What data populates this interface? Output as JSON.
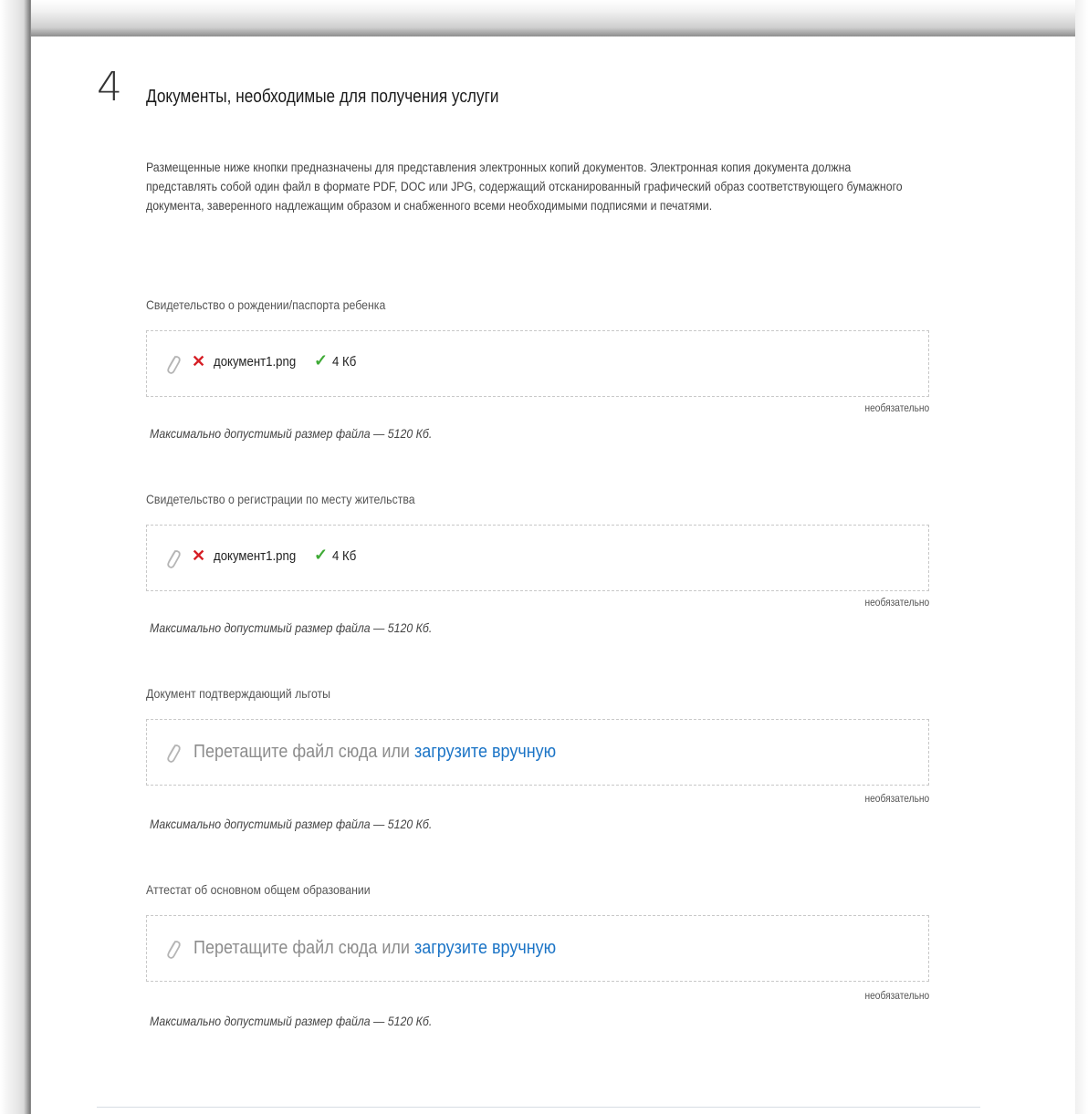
{
  "section": {
    "number": "4",
    "title": "Документы, необходимые для получения услуги",
    "intro": "Размещенные ниже кнопки предназначены для представления электронных копий документов. Электронная копия документа должна представлять собой один файл в формате PDF, DOC или JPG, содержащий отсканированный графический образ соответствующего бумажного документа, заверенного надлежащим образом и снабженного всеми необходимыми подписями и печатями."
  },
  "documents": [
    {
      "label": "Свидетельство о рождении/паспорта ребенка",
      "file_name": "документ1.png",
      "file_size": "4 Кб",
      "optional": "необязательно",
      "max_size": "Максимально допустимый размер файла — 5120 Кб."
    },
    {
      "label": "Свидетельство о регистрации по месту жительства",
      "file_name": "документ1.png",
      "file_size": "4 Кб",
      "optional": "необязательно",
      "max_size": "Максимально допустимый размер файла — 5120 Кб."
    },
    {
      "label": "Документ подтверждающий льготы",
      "drop_text": "Перетащите файл сюда или",
      "upload_link": "загрузите вручную",
      "optional": "необязательно",
      "max_size": "Максимально допустимый размер файла — 5120 Кб."
    },
    {
      "label": "Аттестат об основном общем образовании",
      "drop_text": "Перетащите файл сюда или",
      "upload_link": "загрузите вручную",
      "optional": "необязательно",
      "max_size": "Максимально допустимый размер файла — 5120 Кб."
    }
  ],
  "icons": {
    "attach": "paperclip-icon",
    "remove": "remove-x-icon",
    "uploaded": "checkmark-icon"
  },
  "colors": {
    "remove": "#d61f26",
    "uploaded": "#3faa36",
    "link": "#1b74c6"
  }
}
